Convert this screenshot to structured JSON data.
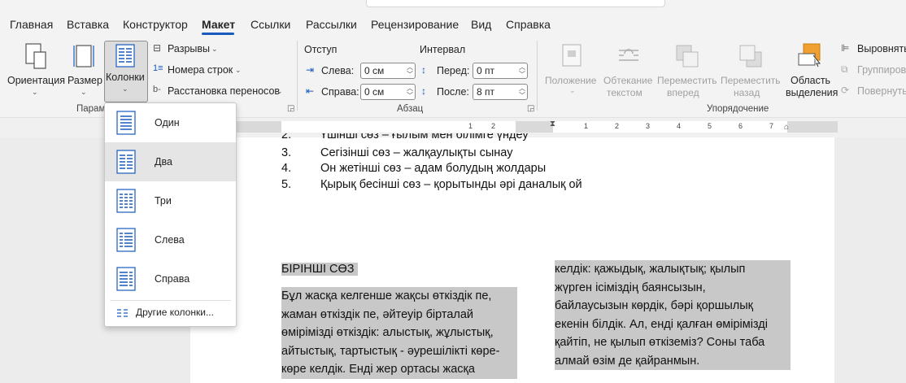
{
  "tabs": [
    "Главная",
    "Вставка",
    "Конструктор",
    "Макет",
    "Ссылки",
    "Рассылки",
    "Рецензирование",
    "Вид",
    "Справка"
  ],
  "active_tab": "Макет",
  "ribbon": {
    "page_setup": {
      "orientation": "Ориентация",
      "size": "Размер",
      "columns": "Колонки",
      "breaks": "Разрывы",
      "line_numbers": "Номера строк",
      "hyphenation": "Расстановка переносов",
      "group_label": "Парам"
    },
    "paragraph": {
      "indent_title": "Отступ",
      "spacing_title": "Интервал",
      "left_label": "Слева:",
      "left_value": "0 см",
      "right_label": "Справа:",
      "right_value": "0 см",
      "before_label": "Перед:",
      "before_value": "0 пт",
      "after_label": "После:",
      "after_value": "8 пт",
      "group_label": "Абзац"
    },
    "arrange": {
      "position": "Положение",
      "wrap_text_1": "Обтекание",
      "wrap_text_2": "текстом",
      "bring_forward_1": "Переместить",
      "bring_forward_2": "вперед",
      "send_backward_1": "Переместить",
      "send_backward_2": "назад",
      "selection_pane_1": "Область",
      "selection_pane_2": "выделения",
      "align": "Выровнять",
      "group": "Группиров",
      "rotate": "Повернуть",
      "group_label": "Упорядочение"
    }
  },
  "ruler_numbers": [
    "1",
    "2",
    "1",
    "2",
    "3",
    "4",
    "5",
    "6",
    "7"
  ],
  "columns_menu": {
    "items": [
      "Один",
      "Два",
      "Три",
      "Слева",
      "Справа"
    ],
    "hovered": "Два",
    "more": "Другие колонки..."
  },
  "document": {
    "partial_line": "Үшінші сөз – ғылым мен білімге үндеу",
    "list": [
      {
        "num": "3.",
        "text": "Сегізінші сөз – жалқаулықты сынау"
      },
      {
        "num": "4.",
        "text": "Он жетінші сөз – адам болудың жолдары"
      },
      {
        "num": "5.",
        "text": "Қырық бесінші сөз – қорытынды әрі даналық ой"
      }
    ],
    "heading": "БІРІНШІ СӨЗ",
    "col1_lines": [
      "Бұл жасқа келгенше жақсы өткіздік пе,",
      "жаман өткіздік пе, әйтеуір бірталай",
      "өмірімізді өткіздік: алыстық, жұлыстық,",
      "айтыстық, тартыстық - әурешілікті көре-",
      "көре келдік. Енді жер ортасы жасқа"
    ],
    "col2_lines": [
      "келдік: қажыдық, жалықтық; қылып",
      "жүрген ісіміздің баянсызын,",
      "байлаусызын көрдік, бәрі қоршылық",
      "екенін білдік. Ал, енді қалған өмірімізді",
      "қайтіп, не қылып өткіземіз? Соны таба",
      "алмай өзім де қайранмын."
    ]
  }
}
